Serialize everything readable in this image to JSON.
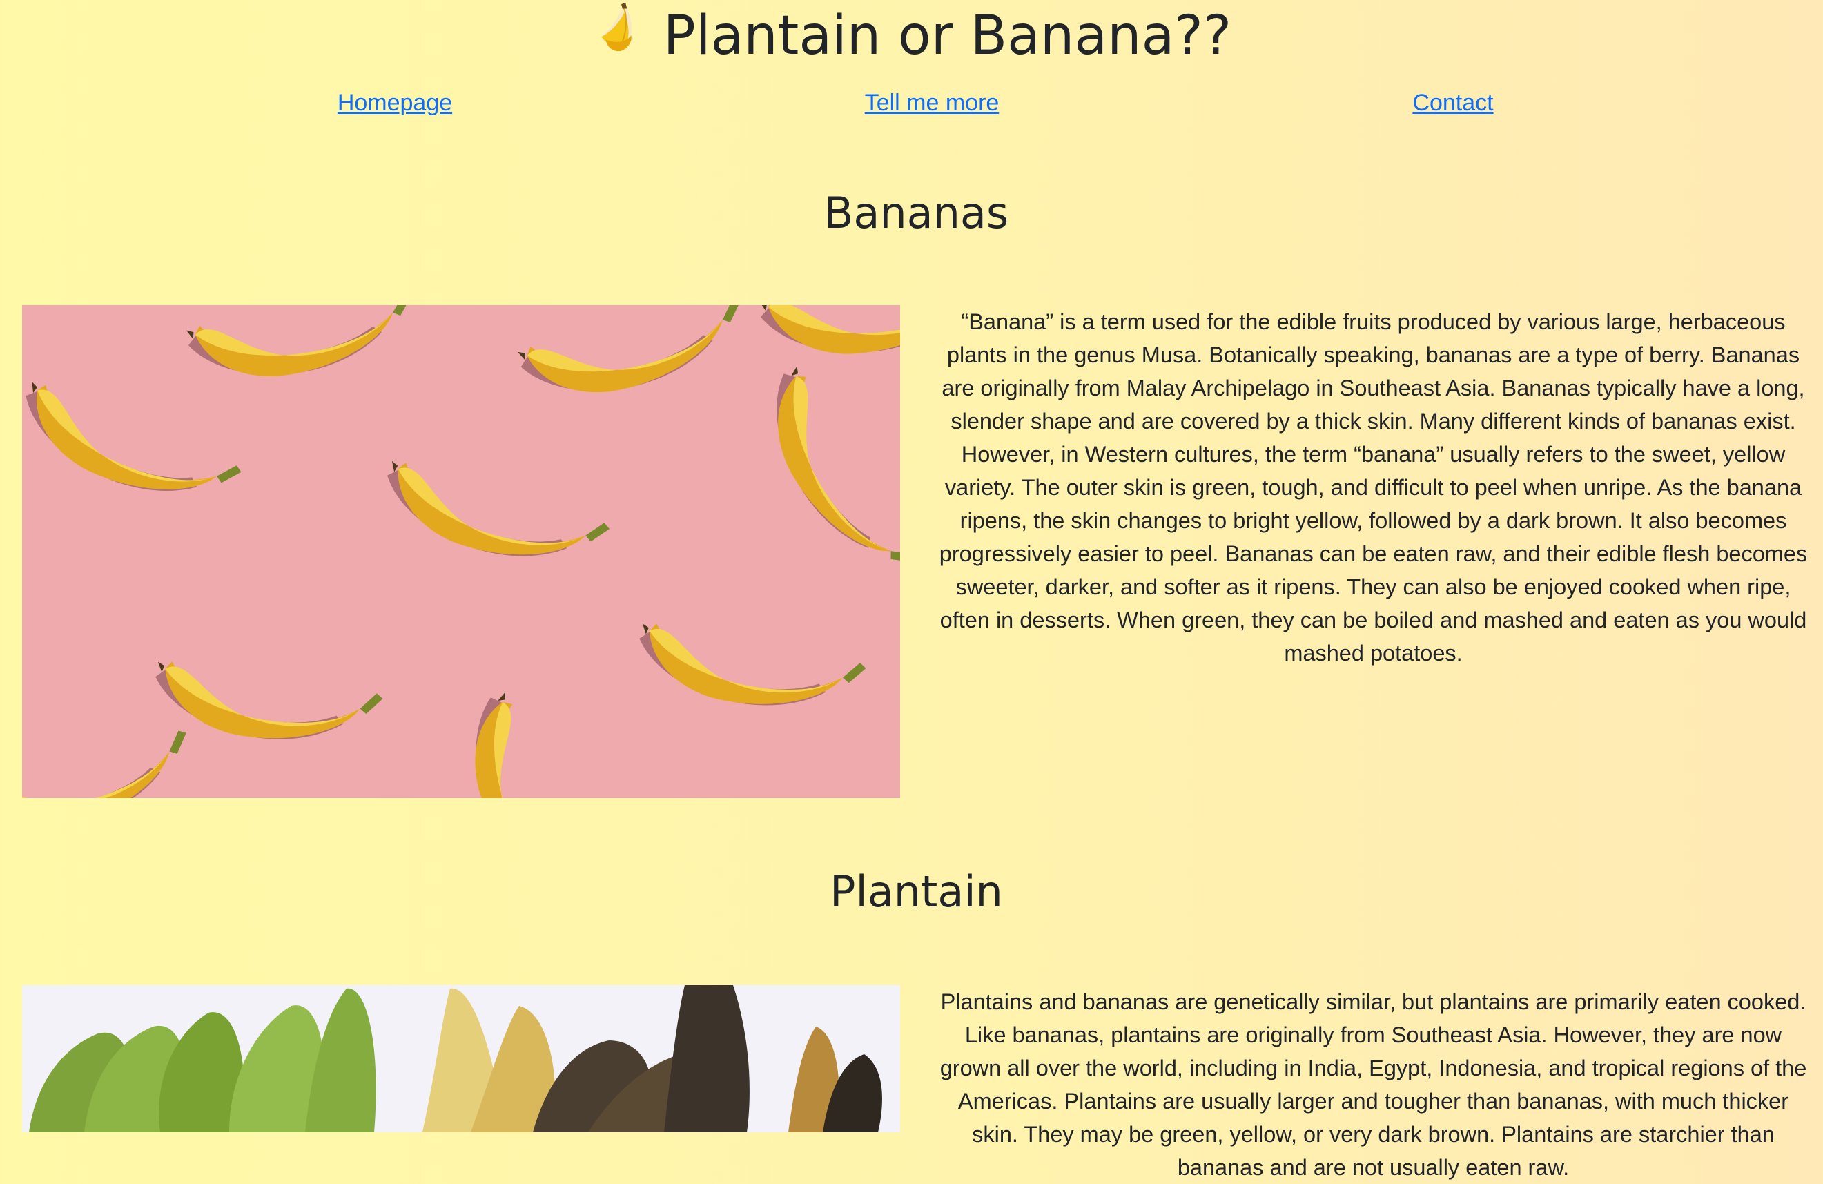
{
  "site": {
    "title": "Plantain or Banana??",
    "logo_icon": "banana-emoji-icon"
  },
  "nav": {
    "items": [
      {
        "label": "Homepage"
      },
      {
        "label": "Tell me more"
      },
      {
        "label": "Contact"
      }
    ]
  },
  "sections": [
    {
      "heading": "Bananas",
      "image_subject": "banana-pattern-on-pink",
      "text": "“Banana” is a term used for the edible fruits produced by various large, herbaceous plants in the genus Musa. Botanically speaking, bananas are a type of berry. Bananas are originally from Malay Archipelago in Southeast Asia. Bananas typically have a long, slender shape and are covered by a thick skin. Many different kinds of bananas exist. However, in Western cultures, the term “banana” usually refers to the sweet, yellow variety. The outer skin is green, tough, and difficult to peel when unripe. As the banana ripens, the skin changes to bright yellow, followed by a dark brown. It also becomes progressively easier to peel. Bananas can be eaten raw, and their edible flesh becomes sweeter, darker, and softer as it ripens. They can also be enjoyed cooked when ripe, often in desserts. When green, they can be boiled and mashed and eaten as you would mashed potatoes."
    },
    {
      "heading": "Plantain",
      "image_subject": "plantains-ripeness-stages",
      "text": "Plantains and bananas are genetically similar, but plantains are primarily eaten cooked. Like bananas, plantains are originally from Southeast Asia. However, they are now grown all over the world, including in India, Egypt, Indonesia, and tropical regions of the Americas. Plantains are usually larger and tougher than bananas, with much thicker skin. They may be green, yellow, or very dark brown. Plantains are starchier than bananas and are not usually eaten raw."
    }
  ],
  "colors": {
    "background_left": "#fff9a8",
    "background_right": "#ffe9b6",
    "link": "#0d6efd",
    "text": "#212529",
    "banana_photo_bg": "#efaaae",
    "plantain_photo_bg": "#f2f2f8"
  }
}
